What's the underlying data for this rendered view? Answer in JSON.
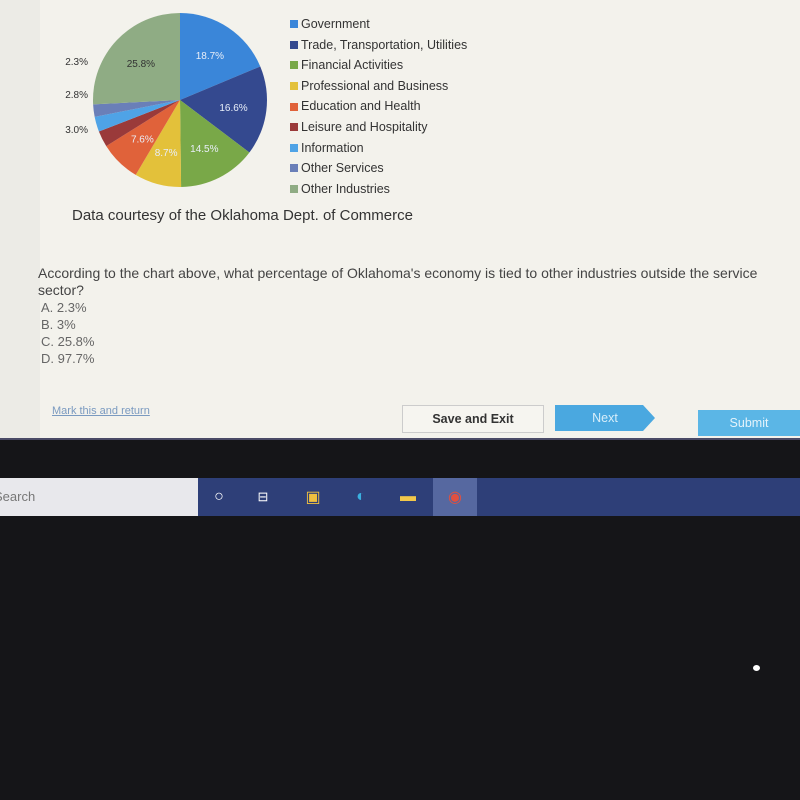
{
  "chart_data": {
    "type": "pie",
    "slices": [
      {
        "name": "Government",
        "value": 18.7,
        "label": "18.7%",
        "color": "#3a86d9"
      },
      {
        "name": "Trade, Transportation, Utilities",
        "value": 16.6,
        "label": "16.6%",
        "color": "#34498f"
      },
      {
        "name": "Financial Activities",
        "value": 14.5,
        "label": "14.5%",
        "color": "#79a848"
      },
      {
        "name": "Professional and Business",
        "value": 8.7,
        "label": "8.7%",
        "color": "#e3c13a"
      },
      {
        "name": "Education and Health",
        "value": 7.6,
        "label": "7.6%",
        "color": "#e0623a"
      },
      {
        "name": "Leisure and Hospitality",
        "value": 3.0,
        "label": "3.0%",
        "color": "#9a3a3a"
      },
      {
        "name": "Information",
        "value": 2.8,
        "label": "2.8%",
        "color": "#4fa3e6"
      },
      {
        "name": "Other Services",
        "value": 2.3,
        "label": "2.3%",
        "color": "#6a7fb8"
      },
      {
        "name": "Other Industries",
        "value": 25.8,
        "label": "25.8%",
        "color": "#8fac84"
      }
    ],
    "legend_position": "right"
  },
  "credit": "Data courtesy of the Oklahoma Dept. of Commerce",
  "question": {
    "text": "According to the chart above, what percentage of Oklahoma's economy is tied to other industries outside the service sector?",
    "options": [
      "A.  2.3%",
      "B.  3%",
      "C.  25.8%",
      "D.  97.7%"
    ]
  },
  "footer": {
    "mark_link": "Mark this and return",
    "save_exit": "Save and Exit",
    "next": "Next",
    "submit": "Submit"
  },
  "taskbar": {
    "search_placeholder": "Search"
  }
}
